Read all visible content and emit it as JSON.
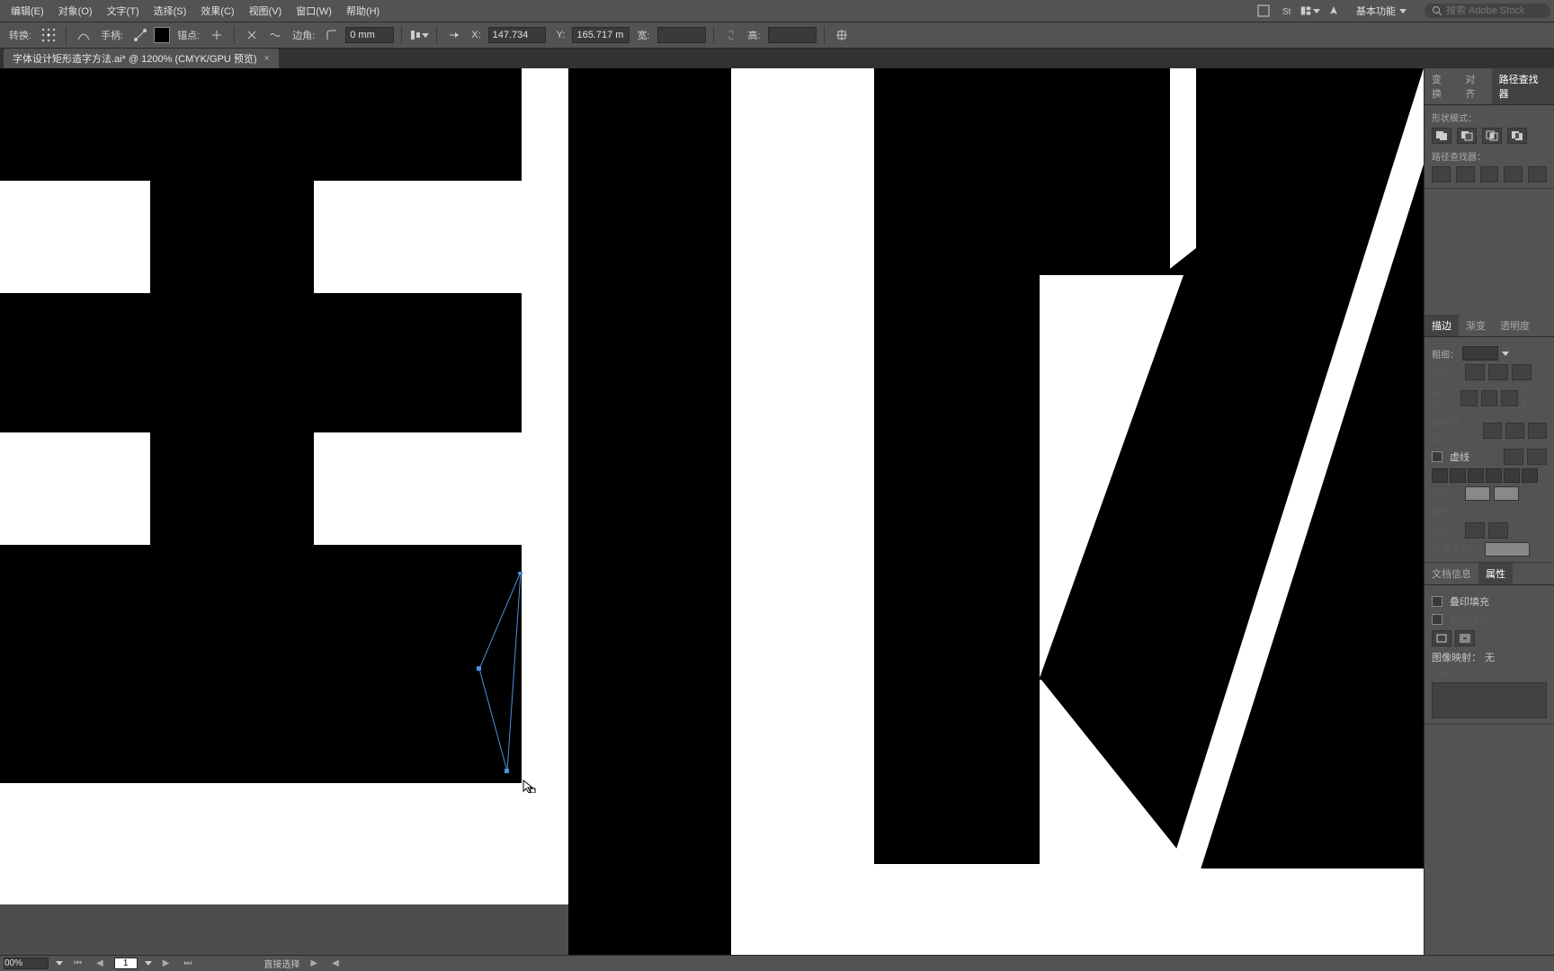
{
  "menu": {
    "edit": "编辑(E)",
    "object": "对象(O)",
    "type": "文字(T)",
    "select": "选择(S)",
    "effect": "效果(C)",
    "view": "视图(V)",
    "window": "窗口(W)",
    "help": "帮助(H)"
  },
  "workspace": {
    "label": "基本功能"
  },
  "search": {
    "placeholder": "搜索 Adobe Stock"
  },
  "toolbar": {
    "transform_label": "转换:",
    "handle_label": "手柄:",
    "anchor_label": "锚点:",
    "corner_label": "边角:",
    "corner_value": "0 mm",
    "x_label": "X:",
    "x_value": "147.734",
    "y_label": "Y:",
    "y_value": "165.717 m",
    "w_label": "宽:",
    "w_value": "",
    "h_label": "高:",
    "h_value": ""
  },
  "document": {
    "tab_title": "字体设计矩形造字方法.ai* @ 1200% (CMYK/GPU 预览)"
  },
  "panelTabs1": [
    "变换",
    "对齐",
    "路径查找器"
  ],
  "pathfinder": {
    "shape_mode_label": "形状模式：",
    "pathfinder_label": "路径查找器："
  },
  "panelTabs2": [
    "描边",
    "渐变",
    "透明度"
  ],
  "stroke": {
    "weight_label": "粗细：",
    "cap_label": "端点：",
    "corner_label": "边角：",
    "limit_label": "限制：",
    "align_label": "对齐描边：",
    "dashed_label": "虚线",
    "arrow_label": "箭头：",
    "scale_label": "缩放：",
    "align_arrow_label": "对齐：",
    "profile_label": "配置文件："
  },
  "panelTabs3": [
    "文档信息",
    "属性"
  ],
  "attributes": {
    "overprint_fill": "叠印填充",
    "overprint_stroke": "叠印描边",
    "image_map_label": "图像映射：",
    "image_map_value": "无",
    "url_label": "URL"
  },
  "status": {
    "zoom": "00%",
    "artboard_nav": "1",
    "mode_label": "直接选择"
  }
}
